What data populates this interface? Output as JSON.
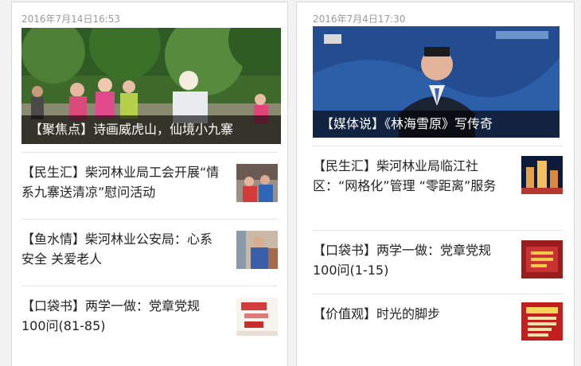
{
  "left": {
    "date": "2016年7月14日16:53",
    "hero_caption": "【聚焦点】诗画威虎山，仙境小九寨",
    "items": [
      {
        "text": "【民生汇】柴河林业局工会开展“情系九寨送清凉”慰问活动"
      },
      {
        "text": "【鱼水情】柴河林业公安局：心系安全 关爱老人"
      },
      {
        "text": "【口袋书】两学一做：党章党规100问(81-85)"
      }
    ]
  },
  "right": {
    "date": "2016年7月4日17:30",
    "hero_caption": "【媒体说】《林海雪原》写传奇",
    "items": [
      {
        "text": "【民生汇】柴河林业局临江社区：“网格化”管理 “零距离”服务"
      },
      {
        "text": "【口袋书】两学一做：党章党规100问(1-15)"
      },
      {
        "text": "【价值观】时光的脚步"
      }
    ]
  }
}
